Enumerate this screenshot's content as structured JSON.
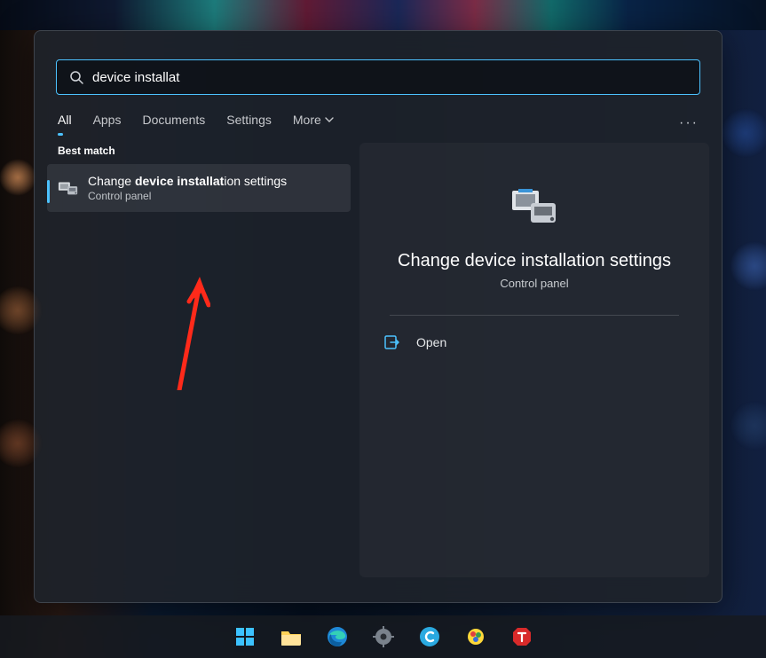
{
  "colors": {
    "accent": "#4cc2ff",
    "annotation": "#ff2a1a"
  },
  "search": {
    "query": "device installat"
  },
  "tabs": {
    "items": [
      "All",
      "Apps",
      "Documents",
      "Settings",
      "More"
    ],
    "active_index": 0,
    "more_has_chevron": true
  },
  "results": {
    "section_label": "Best match",
    "items": [
      {
        "title_prefix": "Change ",
        "title_match": "device installat",
        "title_suffix": "ion settings",
        "subtitle": "Control panel",
        "icon": "devices-printer-icon"
      }
    ]
  },
  "detail": {
    "title": "Change device installation settings",
    "subtitle": "Control panel",
    "actions": [
      {
        "icon": "open-exit-icon",
        "label": "Open"
      }
    ]
  },
  "taskbar": {
    "items": [
      {
        "name": "start-button",
        "icon": "windows-logo-icon"
      },
      {
        "name": "file-explorer-button",
        "icon": "folder-icon"
      },
      {
        "name": "edge-button",
        "icon": "edge-icon"
      },
      {
        "name": "settings-button",
        "icon": "gear-icon"
      },
      {
        "name": "app-c-button",
        "icon": "c-circle-icon"
      },
      {
        "name": "creative-app-button",
        "icon": "creative-icon"
      },
      {
        "name": "app-t-button",
        "icon": "t-stop-icon"
      }
    ]
  }
}
